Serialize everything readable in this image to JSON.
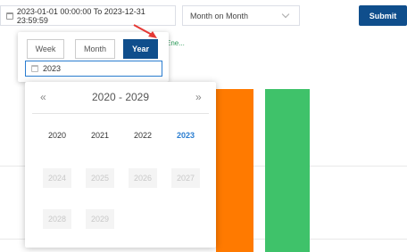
{
  "toolbar": {
    "date_range": "2023-01-01 00:00:00 To 2023-12-31 23:59:59",
    "compare_select": "Month on Month",
    "submit_label": "Submit"
  },
  "chart": {
    "legend_text": "N/Ene...",
    "bar_colors": {
      "orange": "#ff7a00",
      "green": "#3fc26a"
    }
  },
  "picker": {
    "tabs": [
      {
        "label": "Week"
      },
      {
        "label": "Month"
      },
      {
        "label": "Year"
      }
    ],
    "active_tab": "Year",
    "input_value": "2023",
    "prev_label": "«",
    "next_label": "»",
    "decade_label": "2020 - 2029",
    "years": [
      {
        "label": "2020",
        "state": "normal"
      },
      {
        "label": "2021",
        "state": "normal"
      },
      {
        "label": "2022",
        "state": "normal"
      },
      {
        "label": "2023",
        "state": "selected"
      },
      {
        "label": "2024",
        "state": "disabled"
      },
      {
        "label": "2025",
        "state": "disabled"
      },
      {
        "label": "2026",
        "state": "disabled"
      },
      {
        "label": "2027",
        "state": "disabled"
      },
      {
        "label": "2028",
        "state": "disabled"
      },
      {
        "label": "2029",
        "state": "disabled"
      }
    ]
  },
  "colors": {
    "accent": "#0f4e8c",
    "selected_text": "#2a7dd0",
    "arrow": "#e53935"
  }
}
